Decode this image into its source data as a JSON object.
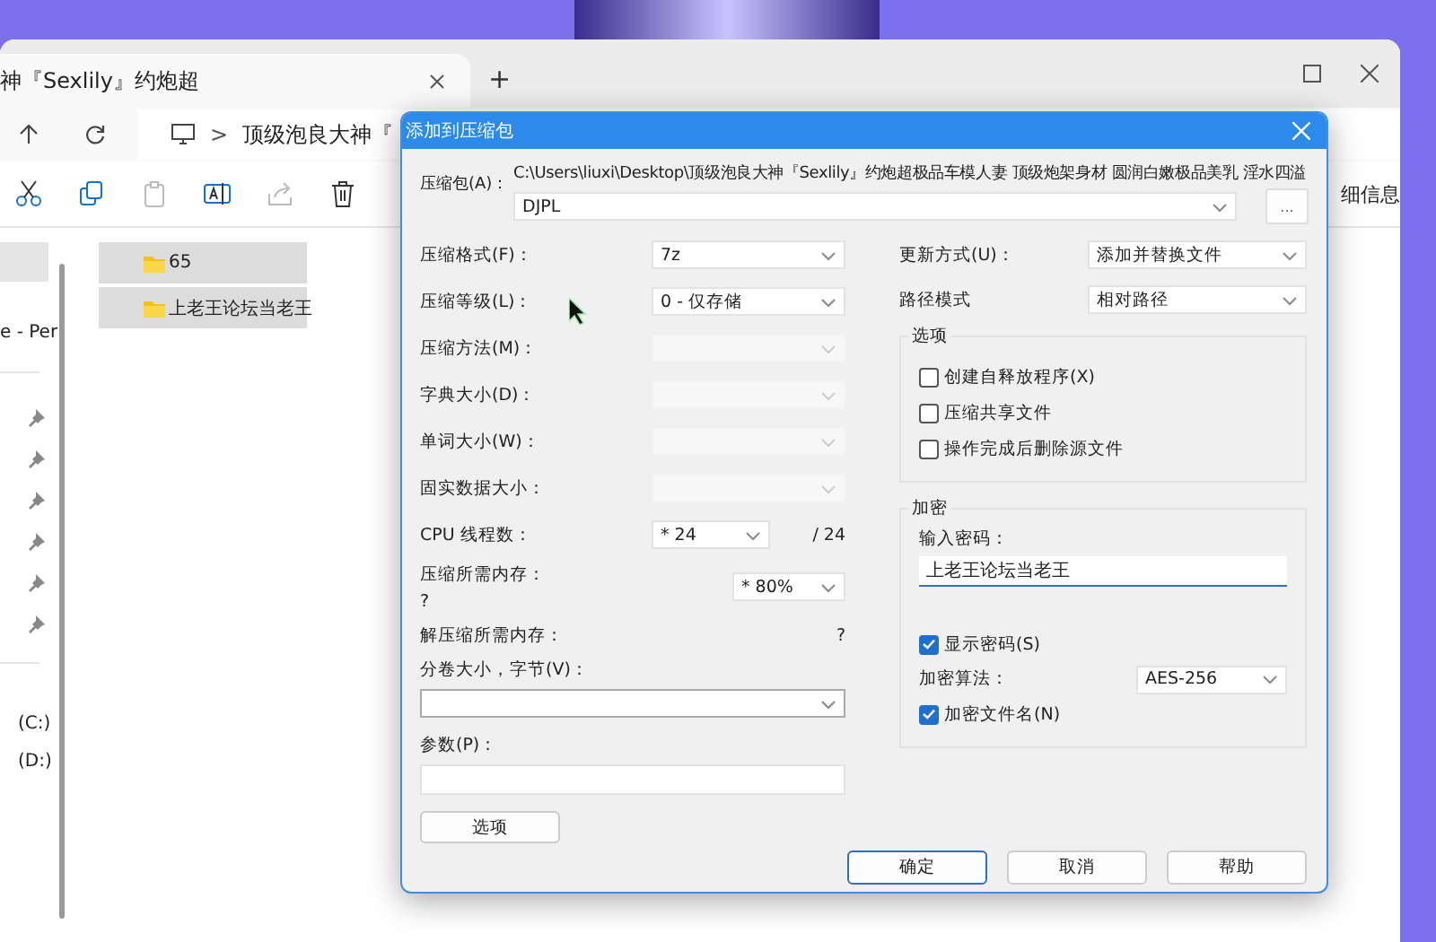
{
  "explorer": {
    "tab_title": "神『Sexlily』约炮超",
    "new_tab": "+",
    "breadcrumb_separator": ">",
    "address_crumb": "顶级泡良大神『",
    "toolbar_label": "细信息",
    "nav_items": [
      {
        "label": "e - Per"
      }
    ],
    "quick_access": [
      {
        "pinned": true
      },
      {
        "pinned": true
      },
      {
        "pinned": true
      },
      {
        "pinned": true
      },
      {
        "pinned": true
      },
      {
        "pinned": true
      }
    ],
    "drives": [
      {
        "label": "(C:)"
      },
      {
        "label": "(D:)"
      }
    ],
    "files": [
      {
        "name": "65",
        "selected": true
      },
      {
        "name": "上老王论坛当老王",
        "selected": true
      }
    ]
  },
  "dialog": {
    "title": "添加到压缩包",
    "archive": {
      "label": "压缩包(A)：",
      "path": "C:\\Users\\liuxi\\Desktop\\顶级泡良大神『Sexlily』约炮超极品车模人妻 顶级炮架身材 圆润白嫩极品美乳 淫水四溢",
      "value": "DJPL",
      "browse": "..."
    },
    "settings": [
      {
        "label": "压缩格式(F)：",
        "value": "7z",
        "disabled": false
      },
      {
        "label": "压缩等级(L)：",
        "value": "0 - 仅存储",
        "disabled": false
      },
      {
        "label": "压缩方法(M)：",
        "disabled": true
      },
      {
        "label": "字典大小(D)：",
        "disabled": true
      },
      {
        "label": "单词大小(W)：",
        "disabled": true
      },
      {
        "label": "固实数据大小：",
        "disabled": true
      }
    ],
    "cpu_threads": {
      "label": "CPU 线程数：",
      "value": "* 24",
      "max": "/ 24"
    },
    "compress_memory": {
      "label": "压缩所需内存：",
      "note": "?",
      "value": "* 80%"
    },
    "decompress_memory": {
      "label": "解压缩所需内存：",
      "value": "?"
    },
    "volume_size": {
      "label": "分卷大小，字节(V)："
    },
    "parameters": {
      "label": "参数(P)："
    },
    "options_button": "选项",
    "update_mode": {
      "label": "更新方式(U)：",
      "value": "添加并替换文件"
    },
    "path_mode": {
      "label": "路径模式",
      "value": "相对路径"
    },
    "options_group": {
      "title": "选项",
      "checkboxes": [
        {
          "label": "创建自释放程序(X)",
          "checked": false
        },
        {
          "label": "压缩共享文件",
          "checked": false
        },
        {
          "label": "操作完成后删除源文件",
          "checked": false
        }
      ]
    },
    "encryption": {
      "title": "加密",
      "password_label": "输入密码：",
      "password": "上老王论坛当老王",
      "show_password": {
        "label": "显示密码(S)",
        "checked": true
      },
      "method": {
        "label": "加密算法：",
        "value": "AES-256"
      },
      "encrypt_names": {
        "label": "加密文件名(N)",
        "checked": true
      }
    },
    "buttons": [
      {
        "label": "确定",
        "default": true
      },
      {
        "label": "取消",
        "default": false
      },
      {
        "label": "帮助",
        "default": false
      }
    ]
  }
}
